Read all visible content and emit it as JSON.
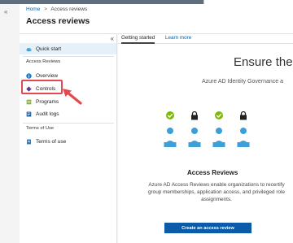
{
  "breadcrumb": {
    "home": "Home",
    "separator": ">",
    "current": "Access reviews"
  },
  "blade_title": "Access reviews",
  "collapse_glyph": "«",
  "sidebar": {
    "quick_start": {
      "label": "Quick start",
      "icon": "cloud-icon"
    },
    "section_access_reviews": "Access Reviews",
    "items": [
      {
        "label": "Overview",
        "icon": "info-icon"
      },
      {
        "label": "Controls",
        "icon": "controls-icon"
      },
      {
        "label": "Programs",
        "icon": "programs-icon"
      },
      {
        "label": "Audit logs",
        "icon": "audit-log-icon"
      }
    ],
    "section_terms": "Terms of Use",
    "terms_item": {
      "label": "Terms of use",
      "icon": "document-icon"
    }
  },
  "tabs": [
    {
      "label": "Getting started",
      "active": true
    },
    {
      "label": "Learn more",
      "active": false
    }
  ],
  "hero": {
    "title": "Ensure the",
    "subtitle": "Azure AD Identity Governance a"
  },
  "card": {
    "title": "Access Reviews",
    "description": "Azure AD Access Reviews enable organizations to recertify group memberships, application access, and privileged role assignments.",
    "cta_label": "Create an access review"
  },
  "colors": {
    "accent": "#0b5ca8",
    "highlight": "#e34a4f",
    "check_green": "#7fba00",
    "person_blue": "#3c9fd8"
  }
}
